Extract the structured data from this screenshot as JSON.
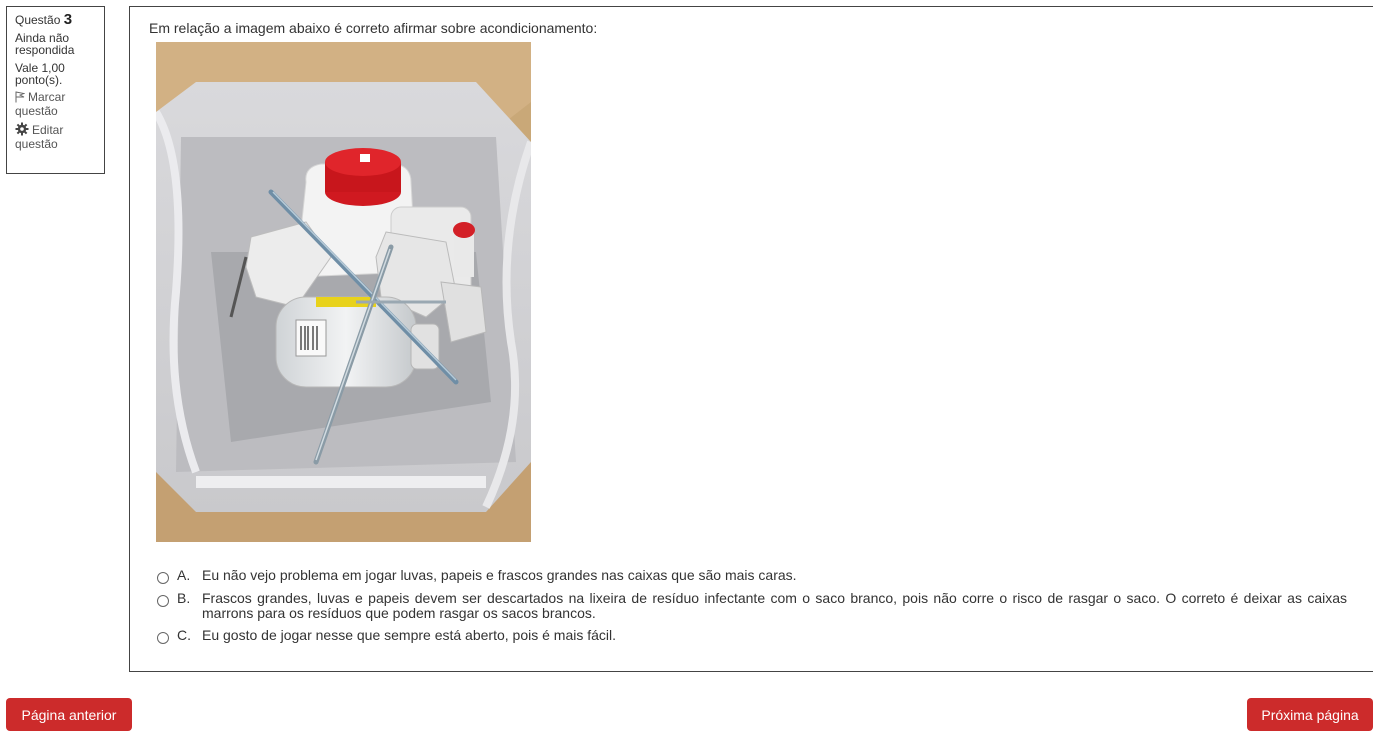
{
  "info": {
    "question_label": "Questão",
    "question_number": "3",
    "state": "Ainda não respondida",
    "grade": "Vale 1,00 ponto(s).",
    "flag_label": "Marcar questão",
    "edit_label": "Editar questão"
  },
  "question": {
    "text": "Em relação a imagem abaixo é correto afirmar sobre acondicionamento:"
  },
  "answers": [
    {
      "letter": "A.",
      "text": "Eu não vejo problema em jogar luvas, papeis e frascos grandes nas caixas que são mais caras."
    },
    {
      "letter": "B.",
      "text": "Frascos grandes, luvas e papeis devem ser descartados na lixeira de resíduo infectante com o saco branco, pois não corre o risco de rasgar o saco. O correto é deixar as caixas marrons para os resíduos que podem rasgar os sacos brancos."
    },
    {
      "letter": "C.",
      "text": "Eu gosto de jogar nesse que sempre está aberto, pois é mais fácil."
    }
  ],
  "nav": {
    "prev_label": "Página anterior",
    "next_label": "Próxima página"
  },
  "colors": {
    "button_bg": "#cc2b2b",
    "border": "#444444",
    "text": "#333333"
  },
  "icons": {
    "flag": "flag-icon",
    "edit": "gear-icon"
  }
}
